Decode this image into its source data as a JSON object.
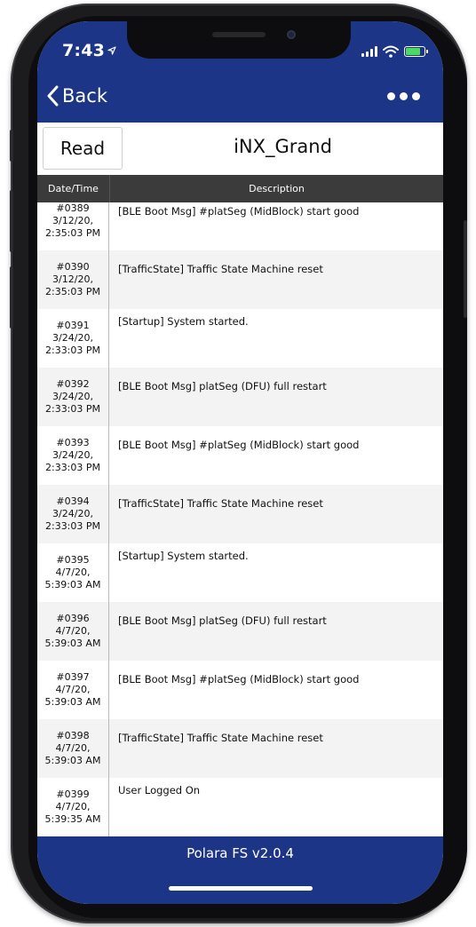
{
  "status_bar": {
    "time": "7:43",
    "icons": [
      "location-arrow-icon",
      "signal-icon",
      "wifi-icon",
      "battery-charging-icon"
    ],
    "battery_color": "#4cd964"
  },
  "nav": {
    "back_label": "Back",
    "more_icon": "ellipsis-icon"
  },
  "header": {
    "read_label": "Read",
    "device_name": "iNX_Grand"
  },
  "table": {
    "columns": [
      "Date/Time",
      "Description"
    ],
    "rows": [
      {
        "id": "#0389",
        "date": "3/12/20,",
        "time": "2:35:03 PM",
        "description": "[BLE Boot Msg] #platSeg (MidBlock) start good"
      },
      {
        "id": "#0390",
        "date": "3/12/20,",
        "time": "2:35:03 PM",
        "description": "[TrafficState] Traffic State Machine reset"
      },
      {
        "id": "#0391",
        "date": "3/24/20,",
        "time": "2:33:03 PM",
        "description": "[Startup] System started."
      },
      {
        "id": "#0392",
        "date": "3/24/20,",
        "time": "2:33:03 PM",
        "description": "[BLE Boot Msg] platSeg (DFU) full restart"
      },
      {
        "id": "#0393",
        "date": "3/24/20,",
        "time": "2:33:03 PM",
        "description": "[BLE Boot Msg] #platSeg (MidBlock) start good"
      },
      {
        "id": "#0394",
        "date": "3/24/20,",
        "time": "2:33:03 PM",
        "description": "[TrafficState] Traffic State Machine reset"
      },
      {
        "id": "#0395",
        "date": "4/7/20,",
        "time": "5:39:03 AM",
        "description": "[Startup] System started."
      },
      {
        "id": "#0396",
        "date": "4/7/20,",
        "time": "5:39:03 AM",
        "description": "[BLE Boot Msg] platSeg (DFU) full restart"
      },
      {
        "id": "#0397",
        "date": "4/7/20,",
        "time": "5:39:03 AM",
        "description": "[BLE Boot Msg] #platSeg (MidBlock) start good"
      },
      {
        "id": "#0398",
        "date": "4/7/20,",
        "time": "5:39:03 AM",
        "description": "[TrafficState] Traffic State Machine reset"
      },
      {
        "id": "#0399",
        "date": "4/7/20,",
        "time": "5:39:35 AM",
        "description": "User Logged On"
      }
    ]
  },
  "footer": {
    "version": "Polara FS v2.0.4"
  },
  "colors": {
    "brand_navy": "#1d3586",
    "header_dark": "#3b3b3b"
  }
}
